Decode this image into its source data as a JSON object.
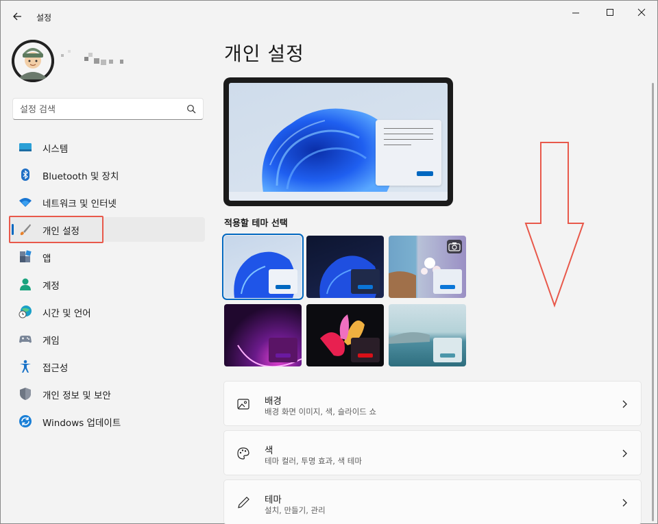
{
  "window": {
    "title": "설정"
  },
  "search": {
    "placeholder": "설정 검색"
  },
  "sidebar": {
    "items": [
      {
        "label": "시스템",
        "icon": "monitor-icon"
      },
      {
        "label": "Bluetooth 및 장치",
        "icon": "bluetooth-icon"
      },
      {
        "label": "네트워크 및 인터넷",
        "icon": "wifi-icon"
      },
      {
        "label": "개인 설정",
        "icon": "paintbrush-icon",
        "active": true
      },
      {
        "label": "앱",
        "icon": "apps-icon"
      },
      {
        "label": "계정",
        "icon": "person-icon"
      },
      {
        "label": "시간 및 언어",
        "icon": "globe-clock-icon"
      },
      {
        "label": "게임",
        "icon": "gamepad-icon"
      },
      {
        "label": "접근성",
        "icon": "accessibility-icon"
      },
      {
        "label": "개인 정보 및 보안",
        "icon": "shield-icon"
      },
      {
        "label": "Windows 업데이트",
        "icon": "update-icon"
      }
    ]
  },
  "main": {
    "title": "개인 설정",
    "theme_section_title": "적용할 테마 선택",
    "cards": [
      {
        "title": "배경",
        "subtitle": "배경 화면 이미지, 색, 슬라이드 쇼",
        "icon": "image-icon"
      },
      {
        "title": "색",
        "subtitle": "테마 컬러, 투명 효과, 색 테마",
        "icon": "palette-icon"
      },
      {
        "title": "테마",
        "subtitle": "설치, 만들기, 관리",
        "icon": "pen-icon"
      }
    ]
  },
  "colors": {
    "accent": "#0067c0",
    "annotation": "#e8584a"
  }
}
